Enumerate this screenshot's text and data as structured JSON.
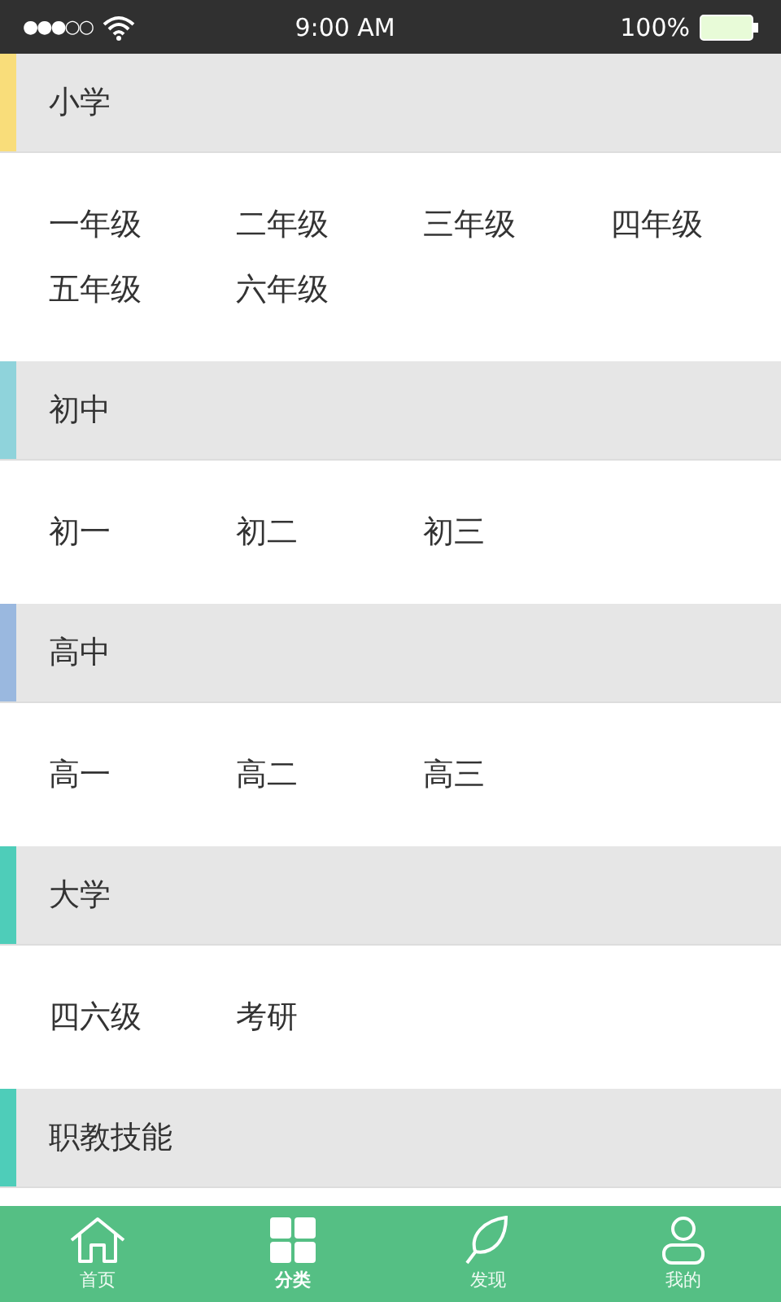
{
  "status_bar": {
    "signal_dots": "●●●○○",
    "time": "9:00 AM",
    "battery": "100%"
  },
  "sections": [
    {
      "title": "小学",
      "color": "#f9dd7a",
      "items": [
        "一年级",
        "二年级",
        "三年级",
        "四年级",
        "五年级",
        "六年级"
      ]
    },
    {
      "title": "初中",
      "color": "#8fd3db",
      "items": [
        "初一",
        "初二",
        "初三"
      ]
    },
    {
      "title": "高中",
      "color": "#9ab8df",
      "items": [
        "高一",
        "高二",
        "高三"
      ]
    },
    {
      "title": "大学",
      "color": "#4ecdb9",
      "items": [
        "四六级",
        "考研"
      ]
    },
    {
      "title": "职教技能",
      "color": "#4ecdb9"
    }
  ],
  "tabs": [
    {
      "kind": "home",
      "label": "首页",
      "selected": false
    },
    {
      "kind": "category",
      "label": "分类",
      "selected": true
    },
    {
      "kind": "discover",
      "label": "发现",
      "selected": false
    },
    {
      "kind": "profile",
      "label": "我的",
      "selected": false
    }
  ]
}
